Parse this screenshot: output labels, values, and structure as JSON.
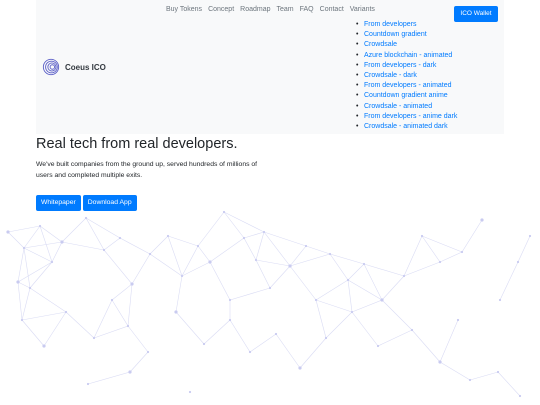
{
  "header": {
    "brand_name": "Coeus ICO",
    "nav": [
      "Buy Tokens",
      "Concept",
      "Roadmap",
      "Team",
      "FAQ",
      "Contact",
      "Variants"
    ],
    "variants": [
      "From developers",
      "Countdown gradient",
      "Crowdsale",
      "Azure blockchain - animated",
      "From developers - dark",
      "Crowdsale - dark",
      "From developers - animated",
      "Countdown gradient anime",
      "Crowdsale - animated",
      "From developers - anime dark",
      "Crowdsale - animated dark"
    ],
    "wallet_label": "ICO Wallet"
  },
  "hero": {
    "title": "Real tech from real developers.",
    "subtitle": "We've built companies from the ground up, served hundreds of millions of users and completed multiple exits.",
    "buttons": [
      "Whitepaper",
      "Download App"
    ]
  },
  "colors": {
    "accent": "#007bff",
    "header_bg": "#f8f9fa",
    "network": "#c9cbf0"
  },
  "icons": {
    "brand": "fingerprint-logo-icon"
  }
}
